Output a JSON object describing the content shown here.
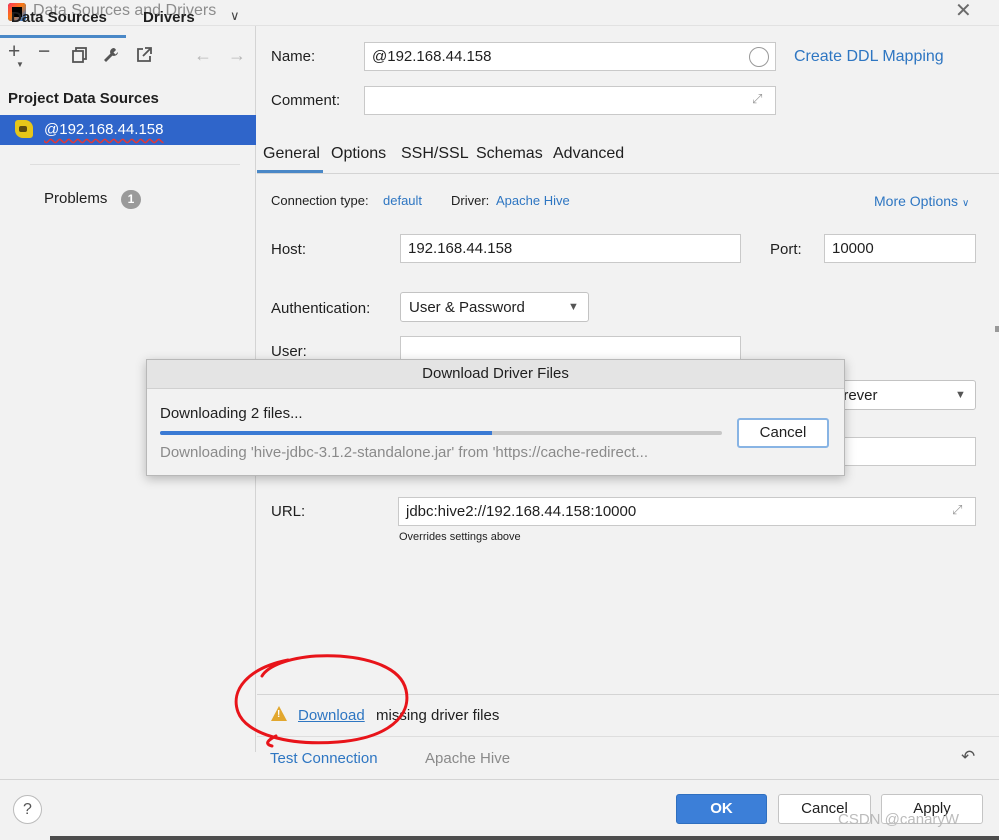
{
  "window": {
    "title": "Data Sources and Drivers",
    "close_icon": "close-icon"
  },
  "left": {
    "tabs": {
      "data_sources": "Data Sources",
      "drivers": "Drivers"
    },
    "toolbar_icons": [
      "add-icon",
      "remove-icon",
      "copy-icon",
      "wrench-icon",
      "jump-to-source-icon",
      "back-arrow-icon",
      "forward-arrow-icon"
    ],
    "section_header": "Project Data Sources",
    "data_source": {
      "label": "@192.168.44.158",
      "icon": "hive-icon"
    },
    "problems": {
      "label": "Problems",
      "count": "1"
    }
  },
  "form": {
    "name_label": "Name:",
    "name_value": "@192.168.44.158",
    "ddl_link": "Create DDL Mapping",
    "comment_label": "Comment:",
    "comment_value": "",
    "tabs": [
      "General",
      "Options",
      "SSH/SSL",
      "Schemas",
      "Advanced"
    ],
    "active_tab": "General",
    "connection_type_label": "Connection type:",
    "connection_type_value": "default",
    "driver_label": "Driver:",
    "driver_value": "Apache Hive",
    "more_options": "More Options",
    "host_label": "Host:",
    "host_value": "192.168.44.158",
    "port_label": "Port:",
    "port_value": "10000",
    "auth_label": "Authentication:",
    "auth_value": "User & Password",
    "user_label": "User:",
    "user_value": "",
    "save_value": "orever",
    "database_value": "",
    "url_label": "URL:",
    "url_value": "jdbc:hive2://192.168.44.158:10000",
    "url_hint": "Overrides settings above"
  },
  "warning": {
    "link": "Download",
    "message": "missing driver files"
  },
  "bottom": {
    "test_connection": "Test Connection",
    "driver_name": "Apache Hive"
  },
  "footer": {
    "help": "?",
    "ok": "OK",
    "cancel": "Cancel",
    "apply": "Apply"
  },
  "modal": {
    "title": "Download Driver Files",
    "status": "Downloading 2 files...",
    "progress": 0.59,
    "detail": "Downloading 'hive-jdbc-3.1.2-standalone.jar' from 'https://cache-redirect...",
    "cancel": "Cancel"
  },
  "watermark": "CSDN @canaryW",
  "colors": {
    "accent": "#2f65ca",
    "link": "#2e76c2",
    "progress": "#3a7ad4",
    "annotation": "#e8141a",
    "warning": "#e2a72e"
  }
}
